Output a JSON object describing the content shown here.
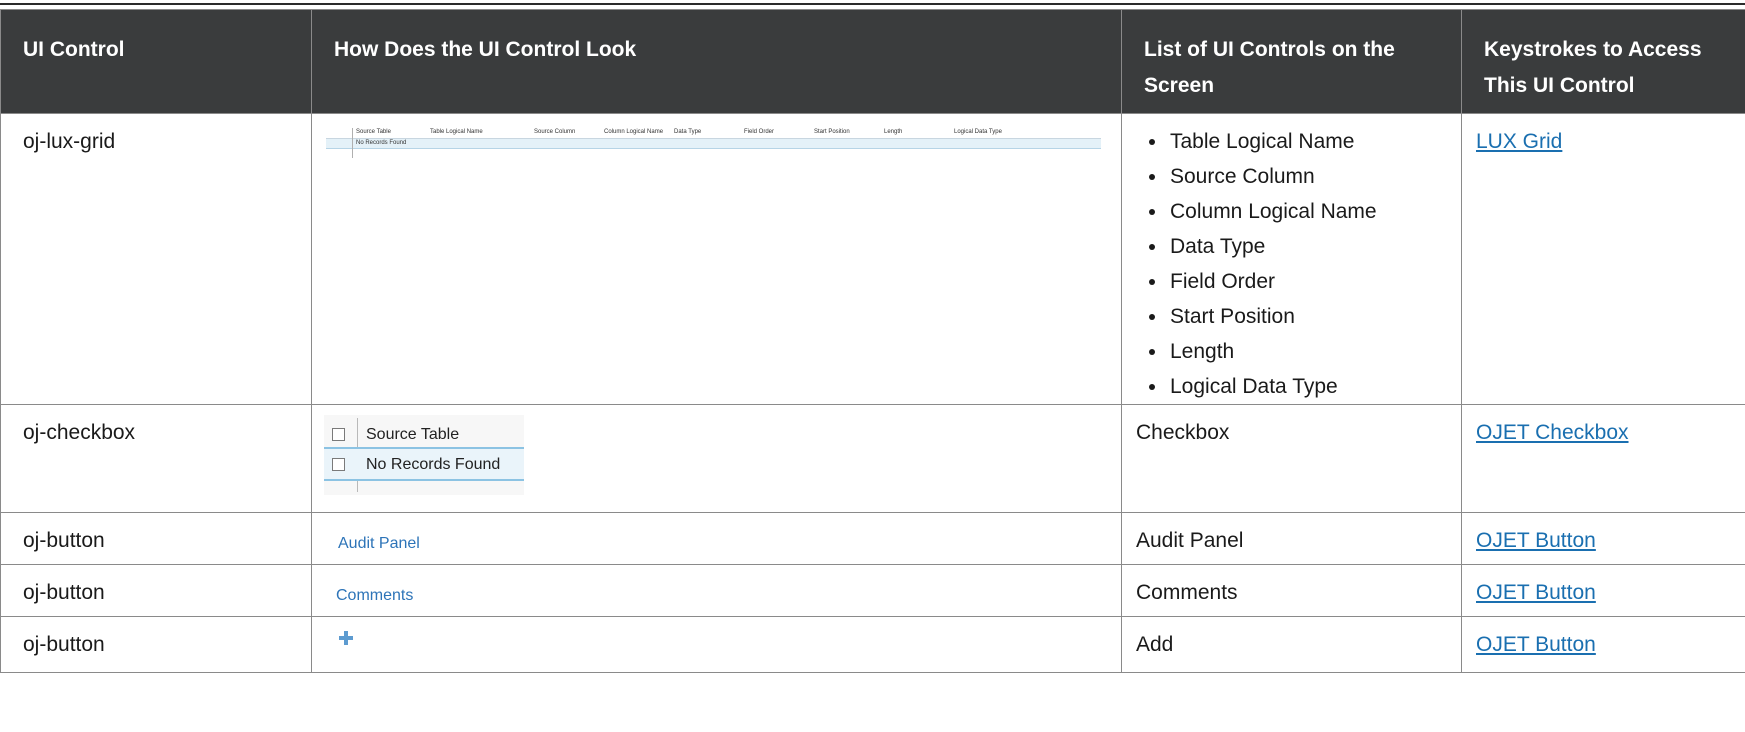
{
  "table": {
    "headers": [
      "UI Control",
      "How Does the UI Control Look",
      "List of UI Controls on the Screen",
      "Keystrokes to Access This UI Control"
    ],
    "rows": [
      {
        "control": "oj-lux-grid",
        "preview": {
          "columns": [
            "Source Table",
            "Table Logical Name",
            "Source Column",
            "Column Logical Name",
            "Data Type",
            "Field Order",
            "Start Position",
            "Length",
            "Logical Data Type"
          ],
          "empty_text": "No Records Found"
        },
        "list": [
          "Table Logical Name",
          "Source Column",
          "Column Logical Name",
          "Data Type",
          "Field Order",
          "Start Position",
          "Length",
          "Logical Data Type"
        ],
        "link": "LUX Grid"
      },
      {
        "control": "oj-checkbox",
        "preview": {
          "header_text": "Source Table",
          "row_text": "No Records Found"
        },
        "list_text": "Checkbox",
        "link": "OJET Checkbox"
      },
      {
        "control": "oj-button",
        "preview_text": "Audit Panel",
        "list_text": "Audit Panel",
        "link": "OJET Button"
      },
      {
        "control": "oj-button",
        "preview_text": "Comments",
        "list_text": "Comments",
        "link": "OJET Button"
      },
      {
        "control": "oj-button",
        "preview_icon": "plus-icon",
        "list_text": "Add",
        "link": "OJET Button"
      }
    ]
  }
}
